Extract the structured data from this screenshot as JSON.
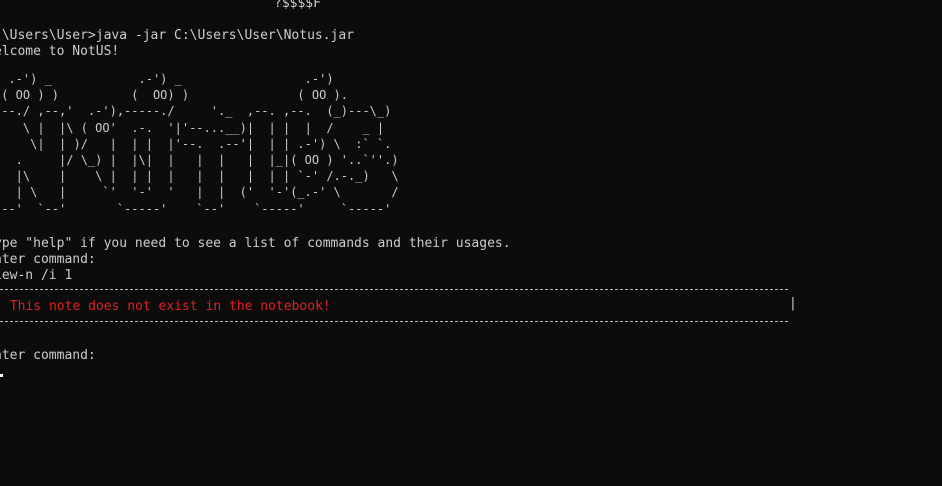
{
  "terminal": {
    "top_fragment": "?$$$$F",
    "launch_command": ":\\Users\\User>java -jar C:\\Users\\User\\Notus.jar",
    "welcome": "elcome to NotUS!",
    "ascii_logo": "  .-') _            .-') _                 .-')\n ( OO ) )          (  OO) )               ( OO ).\n,--./ ,--,'  .-'),-----./     '._  ,--. ,--.  (_)---\\_)\n|   \\ |  |\\ ( OO'  .-.  '|'--...__)|  | |  |  /    _ |\n|    \\|  | )/   |  | |  |'--.  .--'|  | | .-') \\  :` `.\n|  .     |/ \\_) |  |\\|  |   |  |   |  |_|( OO ) '..`''.)\n|  |\\    |    \\ |  | |  |   |  |   |  | | `-' /.-._)   \\\n|  | \\   |     `'  '-'  '   |  |  ('  '-'(_.-' \\       /\n`--'  `--'       `-----'    `--'    `-----'     `-----'",
    "help_hint": "ype \"help\" if you need to see a list of commands and their usages.",
    "prompt_1": "nter command:",
    "user_input": "iew-n /i 1",
    "divider": "----------------------------------------------------------------------------------------------------",
    "error_message": " This note does not exist in the notebook!",
    "box_pipe": "|",
    "prompt_2": "nter command:"
  },
  "colors": {
    "background": "#0c0c0c",
    "text": "#cccccc",
    "error": "#e02020"
  }
}
